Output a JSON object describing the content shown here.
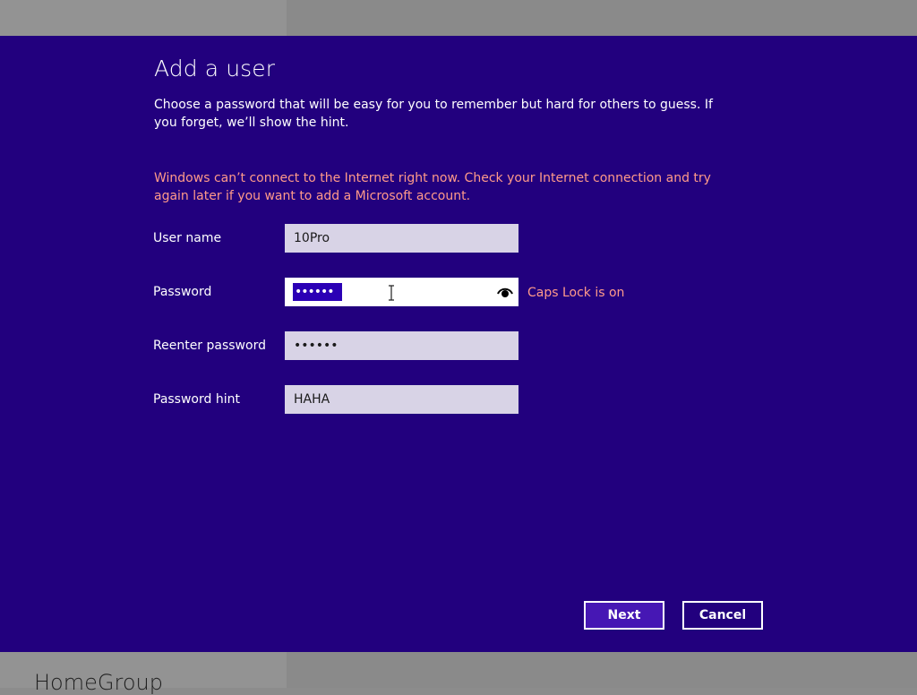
{
  "background": {
    "label": "HomeGroup"
  },
  "dialog": {
    "title": "Add a user",
    "description": "Choose a password that will be easy for you to remember but hard for others to guess. If you forget, we’ll show the hint.",
    "error": "Windows can’t connect to the Internet right now. Check your Internet connection and try again later if you want to add a Microsoft account."
  },
  "form": {
    "username": {
      "label": "User name",
      "value": "10Pro"
    },
    "password": {
      "label": "Password",
      "value": "••••••",
      "warning": "Caps Lock is on"
    },
    "reenter": {
      "label": "Reenter password",
      "value": "••••••"
    },
    "hint": {
      "label": "Password hint",
      "value": "HAHA"
    }
  },
  "buttons": {
    "next": "Next",
    "cancel": "Cancel"
  },
  "colors": {
    "dialog_bg": "#22007e",
    "accent": "#4617b4",
    "error_text": "#ff9a8a",
    "field_bg": "#d8d3e6"
  },
  "icons": {
    "reveal": "eye-icon",
    "text_cursor": "text-cursor-icon"
  }
}
